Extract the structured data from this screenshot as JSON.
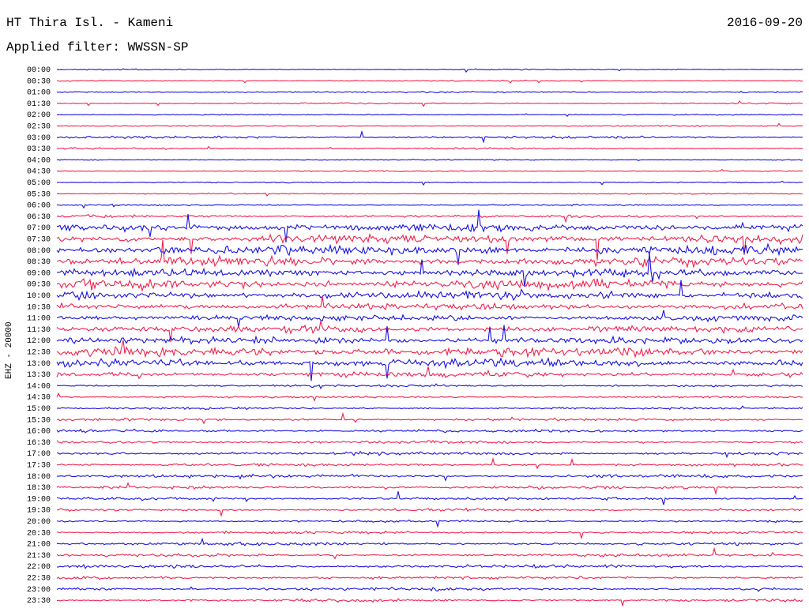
{
  "header": {
    "title": "HT Thira Isl. - Kameni",
    "date": "2016-09-20",
    "filter": "Applied filter: WWSSN-SP"
  },
  "chart_data": {
    "type": "line",
    "ylabel": "EHZ - 20000",
    "row_labels": [
      "00:00",
      "00:30",
      "01:00",
      "01:30",
      "02:00",
      "02:30",
      "03:00",
      "03:30",
      "04:00",
      "04:30",
      "05:00",
      "05:30",
      "06:00",
      "06:30",
      "07:00",
      "07:30",
      "08:00",
      "08:30",
      "09:00",
      "09:30",
      "10:00",
      "10:30",
      "11:00",
      "11:30",
      "12:00",
      "12:30",
      "13:00",
      "13:30",
      "14:00",
      "14:30",
      "15:00",
      "15:30",
      "16:00",
      "16:30",
      "17:00",
      "17:30",
      "18:00",
      "18:30",
      "19:00",
      "19:30",
      "20:00",
      "20:30",
      "21:00",
      "21:30",
      "22:00",
      "22:30",
      "23:00",
      "23:30"
    ],
    "series_colors": [
      "#1a10e0",
      "#f0204e"
    ],
    "noise_level": [
      0.4,
      0.4,
      0.6,
      0.5,
      0.4,
      0.4,
      0.8,
      0.6,
      0.4,
      0.4,
      0.4,
      0.4,
      0.5,
      0.9,
      3.0,
      3.2,
      3.4,
      3.2,
      2.8,
      3.6,
      3.0,
      2.4,
      2.2,
      2.4,
      2.6,
      3.2,
      3.0,
      2.0,
      0.8,
      0.7,
      0.8,
      0.9,
      1.0,
      1.0,
      1.1,
      1.0,
      1.1,
      1.0,
      1.0,
      0.9,
      0.8,
      0.9,
      1.1,
      1.0,
      1.2,
      1.0,
      1.1,
      1.0
    ]
  }
}
